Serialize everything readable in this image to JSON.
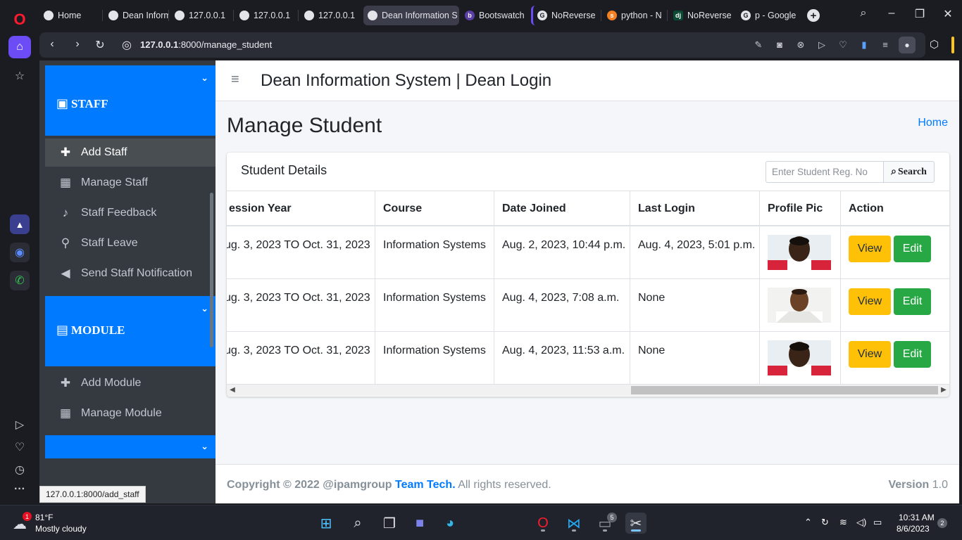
{
  "browser": {
    "tabs": [
      {
        "label": "Home",
        "active": false
      },
      {
        "label": "Dean Inform",
        "active": false
      },
      {
        "label": "127.0.0.1",
        "active": false
      },
      {
        "label": "127.0.0.1",
        "active": false
      },
      {
        "label": "127.0.0.1",
        "active": false
      },
      {
        "label": "Dean Information S",
        "active": true
      },
      {
        "label": "Bootswatch",
        "active": false
      },
      {
        "label": "NoReverse",
        "active": false
      },
      {
        "label": "python - N",
        "active": false
      },
      {
        "label": "NoReverse",
        "active": false
      },
      {
        "label": "p - Google",
        "active": false
      }
    ],
    "url_host": "127.0.0.1",
    "url_path": ":8000/manage_student",
    "status_tooltip": "127.0.0.1:8000/add_staff"
  },
  "sidebar": {
    "staff_header": "STAFF",
    "staff_items": [
      {
        "label": "Add Staff",
        "icon": "plus-icon",
        "active": true
      },
      {
        "label": "Manage Staff",
        "icon": "grid-icon",
        "active": false
      },
      {
        "label": "Staff Feedback",
        "icon": "bell-icon",
        "active": false
      },
      {
        "label": "Staff Leave",
        "icon": "walking-icon",
        "active": false
      },
      {
        "label": "Send Staff Notification",
        "icon": "megaphone-icon",
        "active": false
      }
    ],
    "module_header": "MODULE",
    "module_items": [
      {
        "label": "Add Module",
        "icon": "plus-icon"
      },
      {
        "label": "Manage Module",
        "icon": "grid-icon"
      }
    ]
  },
  "navbar": {
    "title": "Dean Information System | Dean Login"
  },
  "content": {
    "page_title": "Manage Student",
    "breadcrumb": "Home",
    "card_title": "Student Details",
    "search_placeholder": "Enter Student Reg. No",
    "search_button": "Search"
  },
  "table": {
    "columns": [
      "ession Year",
      "Course",
      "Date Joined",
      "Last Login",
      "Profile Pic",
      "Action"
    ],
    "rows": [
      {
        "session": "ug. 3, 2023 TO Oct. 31, 2023",
        "course": "Information Systems",
        "joined": "Aug. 2, 2023, 10:44 p.m.",
        "last_login": "Aug. 4, 2023, 5:01 p.m.",
        "view": "View",
        "edit": "Edit"
      },
      {
        "session": "ug. 3, 2023 TO Oct. 31, 2023",
        "course": "Information Systems",
        "joined": "Aug. 4, 2023, 7:08 a.m.",
        "last_login": "None",
        "view": "View",
        "edit": "Edit"
      },
      {
        "session": "ug. 3, 2023 TO Oct. 31, 2023",
        "course": "Information Systems",
        "joined": "Aug. 4, 2023, 11:53 a.m.",
        "last_login": "None",
        "view": "View",
        "edit": "Edit"
      }
    ]
  },
  "footer": {
    "copyright": "Copyright © 2022 @ipamgroup",
    "team": "Team Tech.",
    "rights": "All rights reserved.",
    "version_label": "Version",
    "version_value": "1.0"
  },
  "taskbar": {
    "weather_temp": "81°F",
    "weather_desc": "Mostly cloudy",
    "weather_badge": "1",
    "app_count_badge": "5",
    "time": "10:31 AM",
    "date": "8/6/2023",
    "notification_count": "2"
  },
  "colors": {
    "primary": "#007bff",
    "sidebar_bg": "#343a40",
    "view_btn": "#ffc107",
    "edit_btn": "#28a745",
    "opera_accent": "#6c4df5"
  }
}
